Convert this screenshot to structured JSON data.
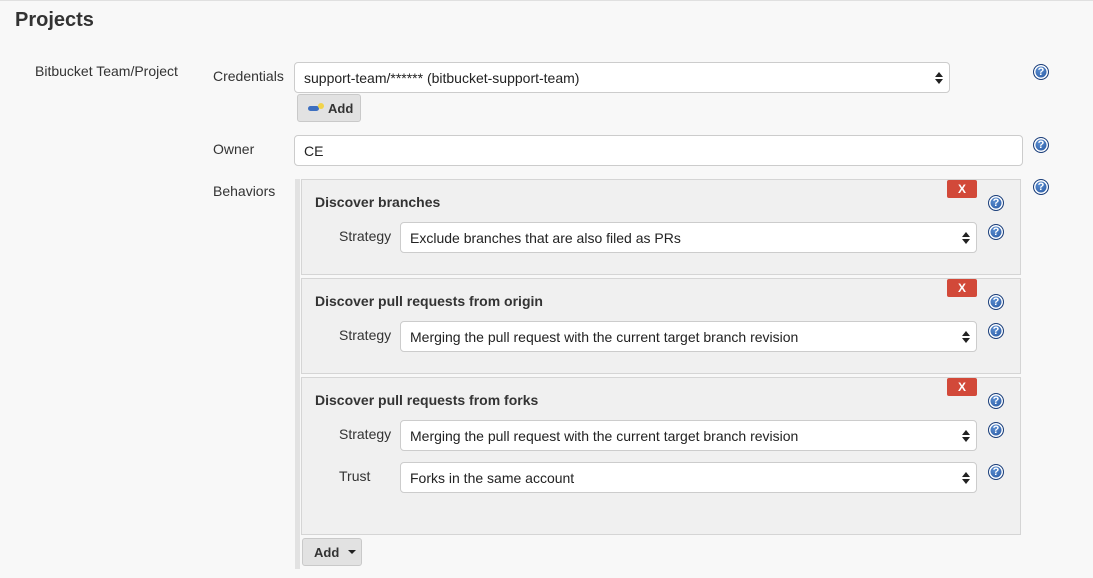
{
  "section": {
    "title": "Projects"
  },
  "project_type_label": "Bitbucket Team/Project",
  "credentials": {
    "label": "Credentials",
    "selected": "support-team/****** (bitbucket-support-team)",
    "add_label": "Add"
  },
  "owner": {
    "label": "Owner",
    "value": "CE"
  },
  "behaviors": {
    "label": "Behaviors",
    "delete_label": "X",
    "items": [
      {
        "title": "Discover branches",
        "fields": [
          {
            "label": "Strategy",
            "selected": "Exclude branches that are also filed as PRs"
          }
        ]
      },
      {
        "title": "Discover pull requests from origin",
        "fields": [
          {
            "label": "Strategy",
            "selected": "Merging the pull request with the current target branch revision"
          }
        ]
      },
      {
        "title": "Discover pull requests from forks",
        "fields": [
          {
            "label": "Strategy",
            "selected": "Merging the pull request with the current target branch revision"
          },
          {
            "label": "Trust",
            "selected": "Forks in the same account"
          }
        ]
      }
    ],
    "add_label": "Add"
  },
  "help_glyph": "?",
  "icons": {
    "help": "help-icon",
    "key": "key-icon",
    "select_arrows": "select-arrows-icon",
    "dropdown": "caret-down-icon"
  }
}
